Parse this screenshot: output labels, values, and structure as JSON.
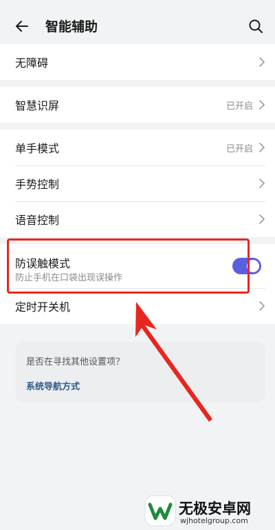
{
  "header": {
    "title": "智能辅助",
    "back_icon": "arrow-left-icon",
    "search_icon": "search-icon"
  },
  "sections": {
    "accessibility": {
      "label": "无障碍"
    },
    "smart_screen": {
      "label": "智慧识屏",
      "status": "已开启"
    },
    "one_hand": {
      "label": "单手模式",
      "status": "已开启"
    },
    "gesture": {
      "label": "手势控制"
    },
    "voice": {
      "label": "语音控制"
    },
    "anti_touch": {
      "label": "防误触模式",
      "sublabel": "防止手机在口袋出现误操作",
      "toggle_on": true
    },
    "scheduled_power": {
      "label": "定时开关机"
    }
  },
  "suggestion": {
    "question": "是否在寻找其他设置项？",
    "link": "系统导航方式"
  },
  "watermark": {
    "name": "无极安卓网",
    "url": "wjhotelgroup.com"
  },
  "colors": {
    "accent": "#5b5ee0",
    "highlight": "#e8261f",
    "link": "#2e5a8a"
  }
}
